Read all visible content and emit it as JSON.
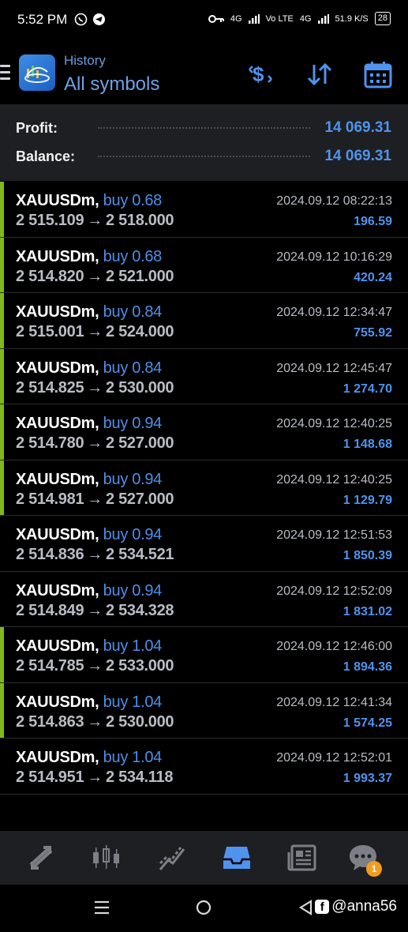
{
  "status_bar": {
    "time": "5:52 PM",
    "network_1": "4G",
    "network_2": "Vo LTE",
    "network_3": "4G",
    "speed": "51.9",
    "speed_unit": "K/S",
    "battery": "28"
  },
  "header": {
    "subtitle": "History",
    "title": "All symbols"
  },
  "summary": {
    "profit_label": "Profit:",
    "profit_value": "14 069.31",
    "balance_label": "Balance:",
    "balance_value": "14 069.31"
  },
  "trades": [
    {
      "symbol": "XAUUSDm,",
      "side": "buy 0.68",
      "open": "2 515.109",
      "close": "2 518.000",
      "time": "2024.09.12 08:22:13",
      "profit": "196.59",
      "marked": true
    },
    {
      "symbol": "XAUUSDm,",
      "side": "buy 0.68",
      "open": "2 514.820",
      "close": "2 521.000",
      "time": "2024.09.12 10:16:29",
      "profit": "420.24",
      "marked": true
    },
    {
      "symbol": "XAUUSDm,",
      "side": "buy 0.84",
      "open": "2 515.001",
      "close": "2 524.000",
      "time": "2024.09.12 12:34:47",
      "profit": "755.92",
      "marked": true
    },
    {
      "symbol": "XAUUSDm,",
      "side": "buy 0.84",
      "open": "2 514.825",
      "close": "2 530.000",
      "time": "2024.09.12 12:45:47",
      "profit": "1 274.70",
      "marked": true
    },
    {
      "symbol": "XAUUSDm,",
      "side": "buy 0.94",
      "open": "2 514.780",
      "close": "2 527.000",
      "time": "2024.09.12 12:40:25",
      "profit": "1 148.68",
      "marked": true
    },
    {
      "symbol": "XAUUSDm,",
      "side": "buy 0.94",
      "open": "2 514.981",
      "close": "2 527.000",
      "time": "2024.09.12 12:40:25",
      "profit": "1 129.79",
      "marked": true
    },
    {
      "symbol": "XAUUSDm,",
      "side": "buy 0.94",
      "open": "2 514.836",
      "close": "2 534.521",
      "time": "2024.09.12 12:51:53",
      "profit": "1 850.39",
      "marked": false
    },
    {
      "symbol": "XAUUSDm,",
      "side": "buy 0.94",
      "open": "2 514.849",
      "close": "2 534.328",
      "time": "2024.09.12 12:52:09",
      "profit": "1 831.02",
      "marked": false
    },
    {
      "symbol": "XAUUSDm,",
      "side": "buy 1.04",
      "open": "2 514.785",
      "close": "2 533.000",
      "time": "2024.09.12 12:46:00",
      "profit": "1 894.36",
      "marked": true
    },
    {
      "symbol": "XAUUSDm,",
      "side": "buy 1.04",
      "open": "2 514.863",
      "close": "2 530.000",
      "time": "2024.09.12 12:41:34",
      "profit": "1 574.25",
      "marked": true
    },
    {
      "symbol": "XAUUSDm,",
      "side": "buy 1.04",
      "open": "2 514.951",
      "close": "2 534.118",
      "time": "2024.09.12 12:52:01",
      "profit": "1 993.37",
      "marked": false
    }
  ],
  "arrow_glyph": "→",
  "tabbar": {
    "tabs": [
      "quotes-icon",
      "chart-icon",
      "trade-icon",
      "history-icon",
      "news-icon",
      "chat-icon"
    ],
    "active": "history-icon",
    "chat_badge": "1"
  },
  "watermark": {
    "fb_glyph": "f",
    "handle": "@anna56"
  },
  "colors": {
    "accent": "#4f93ee",
    "marker": "#7fb81c",
    "background": "#000000",
    "panel": "#1e1f22"
  }
}
